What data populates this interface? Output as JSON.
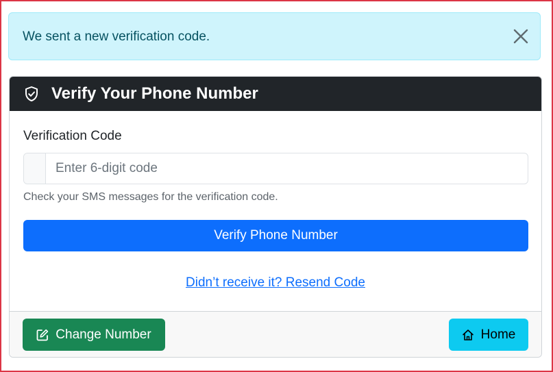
{
  "alert": {
    "message": "We sent a new verification code.",
    "close_icon": "close-icon"
  },
  "card": {
    "header_icon": "shield-check-icon",
    "title": "Verify Your Phone Number",
    "field_label": "Verification Code",
    "input_placeholder": "Enter 6-digit code",
    "input_value": "",
    "help_text": "Check your SMS messages for the verification code.",
    "verify_label": "Verify Phone Number",
    "resend_label": "Didn’t receive it? Resend Code"
  },
  "footer": {
    "change_label": "Change Number",
    "change_icon": "pencil-square-icon",
    "home_label": "Home",
    "home_icon": "house-icon"
  },
  "colors": {
    "frame_border": "#dc3545",
    "alert_bg": "#cff4fc",
    "header_bg": "#212529",
    "primary": "#0d6efd",
    "success": "#198754",
    "info": "#0dcaf0"
  }
}
